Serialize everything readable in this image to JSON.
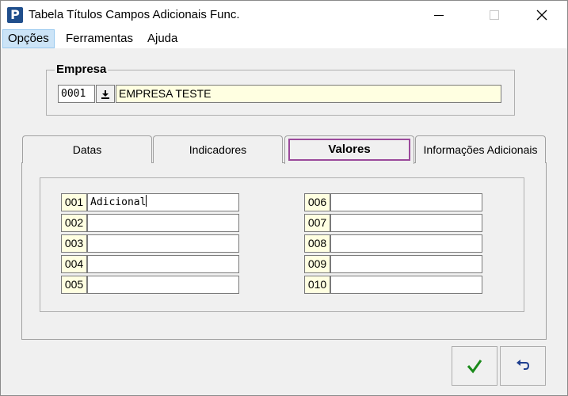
{
  "window": {
    "title": "Tabela Títulos Campos Adicionais Func.",
    "icon_letter": "P"
  },
  "menu": {
    "items": [
      {
        "label": "Opções"
      },
      {
        "label": "Ferramentas"
      },
      {
        "label": "Ajuda"
      }
    ]
  },
  "empresa": {
    "group_label": "Empresa",
    "code": "0001",
    "name": "EMPRESA TESTE"
  },
  "tabs": [
    {
      "label": "Datas"
    },
    {
      "label": "Indicadores"
    },
    {
      "label": "Valores"
    },
    {
      "label": "Informações Adicionais"
    }
  ],
  "valores": {
    "left": [
      {
        "num": "001",
        "value": "Adicional"
      },
      {
        "num": "002",
        "value": ""
      },
      {
        "num": "003",
        "value": ""
      },
      {
        "num": "004",
        "value": ""
      },
      {
        "num": "005",
        "value": ""
      }
    ],
    "right": [
      {
        "num": "006",
        "value": ""
      },
      {
        "num": "007",
        "value": ""
      },
      {
        "num": "008",
        "value": ""
      },
      {
        "num": "009",
        "value": ""
      },
      {
        "num": "010",
        "value": ""
      }
    ]
  },
  "colors": {
    "confirm_check": "#1a8a1a",
    "undo_arrow": "#1f3f8f",
    "tab_focus": "#9b4a9b",
    "field_yellow": "#ffffe1"
  },
  "icons": {
    "app": "app-p-icon",
    "lookup": "download-arrow-icon",
    "confirm": "check-icon",
    "cancel": "undo-icon"
  }
}
